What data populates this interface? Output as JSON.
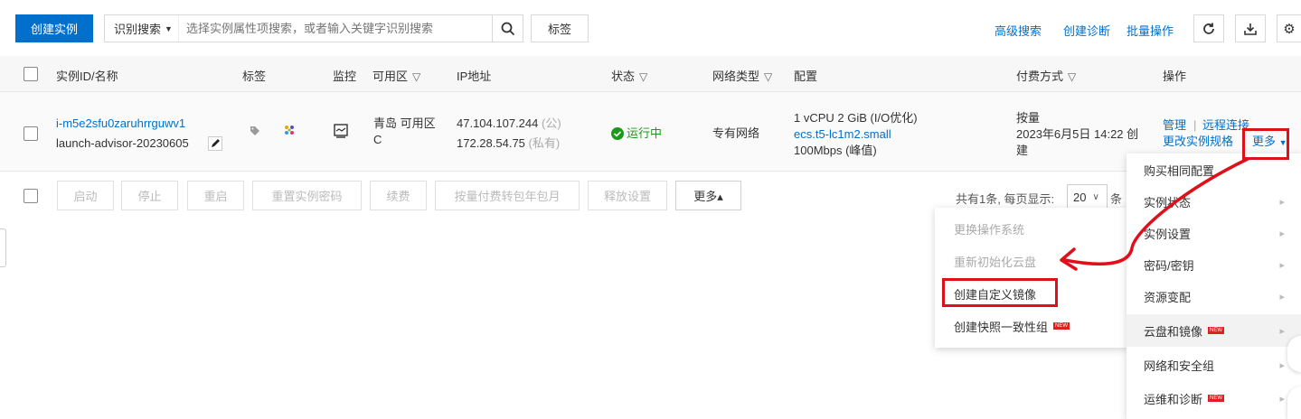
{
  "toolbar": {
    "create_label": "创建实例",
    "search_type": "识别搜索",
    "search_placeholder": "选择实例属性项搜索，或者输入关键字识别搜索",
    "tag_label": "标签",
    "advanced_search": "高级搜索",
    "create_diagnosis": "创建诊断",
    "batch_ops": "批量操作"
  },
  "table": {
    "headers": {
      "id_name": "实例ID/名称",
      "tag": "标签",
      "monitor": "监控",
      "zone": "可用区",
      "ip": "IP地址",
      "status": "状态",
      "network": "网络类型",
      "config": "配置",
      "billing": "付费方式",
      "ops": "操作"
    },
    "row": {
      "instance_id": "i-m5e2sfu0zaruhrrguwv1",
      "instance_name": "launch-advisor-20230605",
      "zone_line1": "青岛 可用区",
      "zone_line2": "C",
      "ip_public": "47.104.107.244",
      "ip_public_tag": "(公)",
      "ip_private": "172.28.54.75",
      "ip_private_tag": "(私有)",
      "status": "运行中",
      "network": "专有网络",
      "config_line1": "1 vCPU 2 GiB  (I/O优化)",
      "config_line2": "ecs.t5-lc1m2.small",
      "config_line3": "100Mbps  (峰值)",
      "billing_line1": "按量",
      "billing_line2": "2023年6月5日 14:22 创",
      "billing_line3": "建",
      "op_manage": "管理",
      "op_separator": "|",
      "op_remote": "远程连接",
      "op_change_spec": "更改实例规格",
      "op_more": "更多"
    }
  },
  "footer": {
    "buttons": [
      "启动",
      "停止",
      "重启",
      "重置实例密码",
      "续费",
      "按量付费转包年包月",
      "释放设置"
    ],
    "more_label": "更多▴",
    "pagination_text": "共有1条, 每页显示:",
    "page_size": "20",
    "page_suffix": "条"
  },
  "menu_right": {
    "items": [
      {
        "label": "购买相同配置",
        "arrow": ""
      },
      {
        "label": "实例状态",
        "arrow": "▸"
      },
      {
        "label": "实例设置",
        "arrow": "▸"
      },
      {
        "label": "密码/密钥",
        "arrow": "▸"
      },
      {
        "label": "资源变配",
        "arrow": "▸"
      },
      {
        "label": "云盘和镜像",
        "arrow": "▸"
      },
      {
        "label": "网络和安全组",
        "arrow": "▸"
      },
      {
        "label": "运维和诊断",
        "arrow": "▸"
      }
    ],
    "new_badge": "NEW"
  },
  "menu_left": {
    "items": [
      {
        "label": "更换操作系统"
      },
      {
        "label": "重新初始化云盘"
      },
      {
        "label": "创建自定义镜像"
      },
      {
        "label": "创建快照一致性组"
      }
    ],
    "new_badge": "NEW"
  },
  "colors": {
    "primary": "#0070cc",
    "running": "#1a9a1a",
    "annotation_red": "#e0101a",
    "new_badge": "#e02020"
  },
  "icons": {
    "search": "search-icon",
    "refresh": "refresh-icon",
    "download": "download-icon",
    "settings": "gear-icon",
    "tag": "tag-icon",
    "monitor": "monitor-icon",
    "edit": "pencil-icon",
    "status": "check-circle-icon"
  }
}
